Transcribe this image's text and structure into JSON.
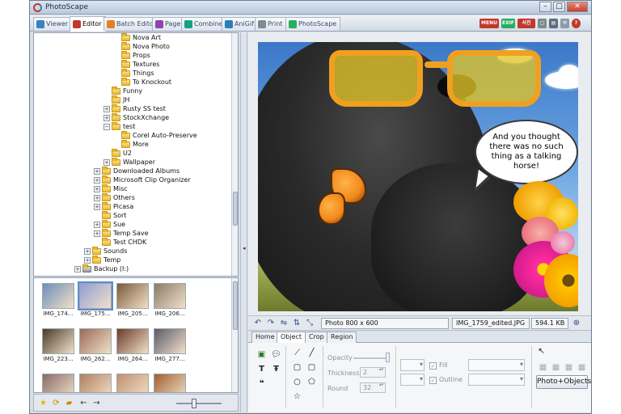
{
  "window": {
    "title": "PhotoScape"
  },
  "tabs": [
    {
      "label": "Viewer",
      "color": "#3b82c4"
    },
    {
      "label": "Editor",
      "color": "#c0392b"
    },
    {
      "label": "Batch Editor",
      "color": "#e67e22"
    },
    {
      "label": "Page",
      "color": "#8e44ad"
    },
    {
      "label": "Combine",
      "color": "#16a085"
    },
    {
      "label": "AniGif",
      "color": "#2980b9"
    },
    {
      "label": "Print",
      "color": "#7f8c8d"
    },
    {
      "label": "PhotoScape",
      "color": "#27ae60"
    }
  ],
  "top_icons": {
    "menu": "MENU",
    "exif": "EXIF",
    "pic": "사진"
  },
  "tree": [
    {
      "label": "Nova Art",
      "level": 3
    },
    {
      "label": "Nova Photo",
      "level": 3
    },
    {
      "label": "Props",
      "level": 3
    },
    {
      "label": "Textures",
      "level": 3
    },
    {
      "label": "Things",
      "level": 3
    },
    {
      "label": "To Knockout",
      "level": 3
    },
    {
      "label": "Funny",
      "level": 2
    },
    {
      "label": "JH",
      "level": 2
    },
    {
      "label": "Rusty SS test",
      "level": 2,
      "expander": "+"
    },
    {
      "label": "StockXchange",
      "level": 2,
      "expander": "+"
    },
    {
      "label": "test",
      "level": 2,
      "expander": "−"
    },
    {
      "label": "Corel Auto-Preserve",
      "level": 3
    },
    {
      "label": "More",
      "level": 3
    },
    {
      "label": "U2",
      "level": 2
    },
    {
      "label": "Wallpaper",
      "level": 2,
      "expander": "+"
    },
    {
      "label": "Downloaded Albums",
      "level": 1,
      "expander": "+"
    },
    {
      "label": "Microsoft Clip Organizer",
      "level": 1,
      "expander": "+"
    },
    {
      "label": "Misc",
      "level": 1,
      "expander": "+"
    },
    {
      "label": "Others",
      "level": 1,
      "expander": "+"
    },
    {
      "label": "Picasa",
      "level": 1,
      "expander": "+"
    },
    {
      "label": "Sort",
      "level": 1
    },
    {
      "label": "Sue",
      "level": 1,
      "expander": "+"
    },
    {
      "label": "Temp Save",
      "level": 1,
      "expander": "+"
    },
    {
      "label": "Test CHDK",
      "level": 1
    },
    {
      "label": "Sounds",
      "level": 0,
      "expander": "+"
    },
    {
      "label": "Temp",
      "level": 0,
      "expander": "+"
    },
    {
      "label": "Backup (I:)",
      "level": -1,
      "expander": "+"
    }
  ],
  "thumbnails": [
    {
      "label": "IMG_174...",
      "color": "#6b8fb8"
    },
    {
      "label": "IMG_175...",
      "color": "#8f9fd6"
    },
    {
      "label": "IMG_205...",
      "color": "#7a5a3a"
    },
    {
      "label": "IMG_206...",
      "color": "#8a7a6a"
    },
    {
      "label": "IMG_223...",
      "color": "#4a3a2a"
    },
    {
      "label": "IMG_262...",
      "color": "#9a6a5a"
    },
    {
      "label": "IMG_264...",
      "color": "#6a3a2a"
    },
    {
      "label": "IMG_277...",
      "color": "#5a5a6a"
    },
    {
      "label": "",
      "color": "#8a6a6a"
    },
    {
      "label": "",
      "color": "#b08060"
    },
    {
      "label": "",
      "color": "#c09070"
    },
    {
      "label": "",
      "color": "#a06030"
    }
  ],
  "photo": {
    "speech_text": "And you thought there was no such thing as a talking horse!"
  },
  "status": {
    "photo_info": "Photo 800 x 600",
    "filename": "IMG_1759_edited.JPG",
    "filesize": "594.1 KB"
  },
  "subtabs": [
    "Home",
    "Object",
    "Crop",
    "Region"
  ],
  "object_panel": {
    "opacity_label": "Opacity",
    "thickness_label": "Thickness",
    "thickness_value": "2",
    "round_label": "Round",
    "round_value": "32",
    "fill_label": "Fill",
    "outline_label": "Outline",
    "photo_objects_button": "Photo+Objects"
  }
}
